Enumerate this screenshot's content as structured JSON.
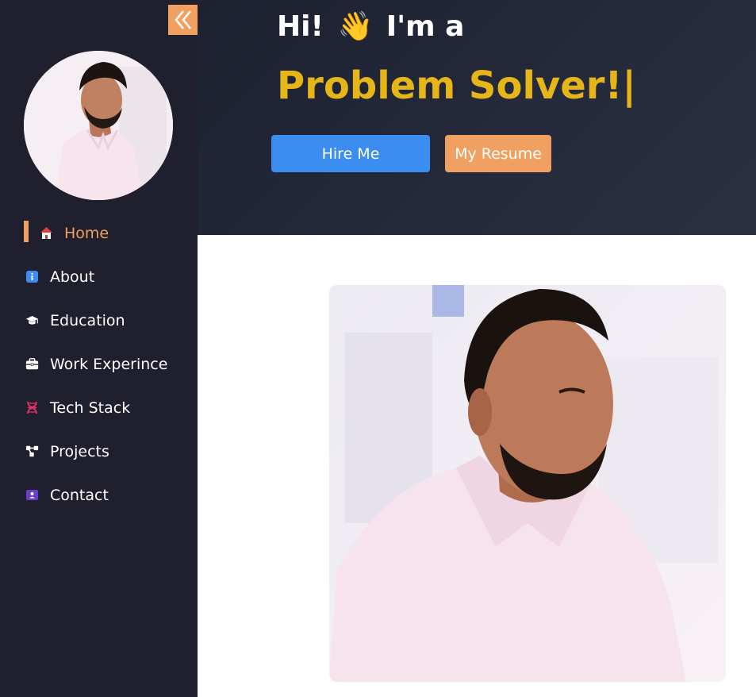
{
  "sidebar": {
    "collapse_icon": "double-chevron-left-icon",
    "avatar_alt": "profile photo",
    "items": [
      {
        "label": "Home",
        "icon": "home-icon",
        "active": true
      },
      {
        "label": "About",
        "icon": "info-icon",
        "active": false
      },
      {
        "label": "Education",
        "icon": "graduation-cap-icon",
        "active": false
      },
      {
        "label": "Work Experince",
        "icon": "briefcase-icon",
        "active": false
      },
      {
        "label": "Tech Stack",
        "icon": "dna-icon",
        "active": false
      },
      {
        "label": "Projects",
        "icon": "network-icon",
        "active": false
      },
      {
        "label": "Contact",
        "icon": "contact-card-icon",
        "active": false
      }
    ]
  },
  "hero": {
    "greeting_start": "Hi!",
    "wave": "👋",
    "greeting_end": "I'm a",
    "typed_text": "Problem Solver!|",
    "hire_button": "Hire Me",
    "resume_button": "My Resume"
  },
  "colors": {
    "sidebar_bg": "#1f1f2e",
    "accent_orange": "#f0a060",
    "accent_yellow": "#e6b517",
    "accent_blue": "#3b8ef0"
  }
}
